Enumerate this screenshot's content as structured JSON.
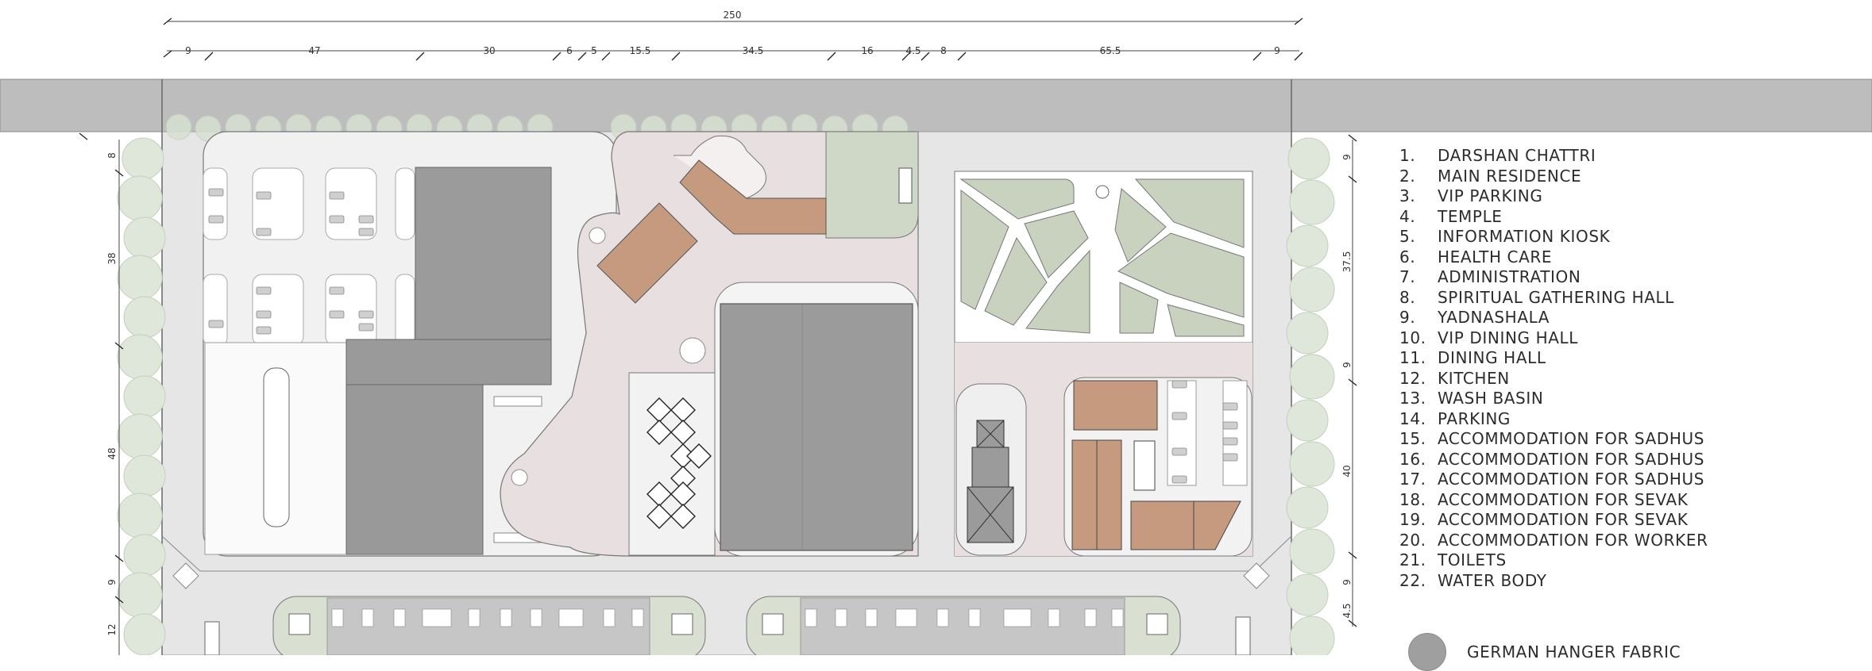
{
  "dimensions": {
    "top_total": "250",
    "top_segments": [
      "9",
      "47",
      "30",
      "6",
      "5",
      "15.5",
      "34.5",
      "16",
      "4.5",
      "8",
      "65.5",
      "9"
    ],
    "left_segments": [
      "8",
      "38",
      "48",
      "9",
      "12"
    ],
    "right_segments": [
      "9",
      "37.5",
      "9",
      "40",
      "9",
      "4.5"
    ]
  },
  "legend": {
    "items": [
      {
        "num": "1.",
        "label": "DARSHAN CHATTRI"
      },
      {
        "num": "2.",
        "label": "MAIN RESIDENCE"
      },
      {
        "num": "3.",
        "label": "VIP PARKING"
      },
      {
        "num": "4.",
        "label": "TEMPLE"
      },
      {
        "num": "5.",
        "label": "INFORMATION KIOSK"
      },
      {
        "num": "6.",
        "label": "HEALTH CARE"
      },
      {
        "num": "7.",
        "label": "ADMINISTRATION"
      },
      {
        "num": "8.",
        "label": "SPIRITUAL GATHERING HALL"
      },
      {
        "num": "9.",
        "label": "YADNASHALA"
      },
      {
        "num": "10.",
        "label": "VIP DINING HALL"
      },
      {
        "num": "11.",
        "label": "DINING HALL"
      },
      {
        "num": "12.",
        "label": "KITCHEN"
      },
      {
        "num": "13.",
        "label": "WASH BASIN"
      },
      {
        "num": "14.",
        "label": "PARKING"
      },
      {
        "num": "15.",
        "label": "ACCOMMODATION FOR SADHUS"
      },
      {
        "num": "16.",
        "label": "ACCOMMODATION FOR SADHUS"
      },
      {
        "num": "17.",
        "label": "ACCOMMODATION FOR SADHUS"
      },
      {
        "num": "18.",
        "label": "ACCOMMODATION FOR SEVAK"
      },
      {
        "num": "19.",
        "label": "ACCOMMODATION FOR SEVAK"
      },
      {
        "num": "20.",
        "label": "ACCOMMODATION FOR WORKER"
      },
      {
        "num": "21.",
        "label": "TOILETS"
      },
      {
        "num": "22.",
        "label": "WATER BODY"
      }
    ],
    "material": {
      "label": "GERMAN HANGER FABRIC",
      "color": "#9f9f9f"
    }
  },
  "colors": {
    "road": "#bdbdbd",
    "site": "#e6e6e6",
    "plaza": "#e8dfe0",
    "building": "#9b9b9b",
    "roof_brown": "#c59a7f",
    "lawn": "#c9d2bf",
    "tree": "#dde6d8"
  }
}
